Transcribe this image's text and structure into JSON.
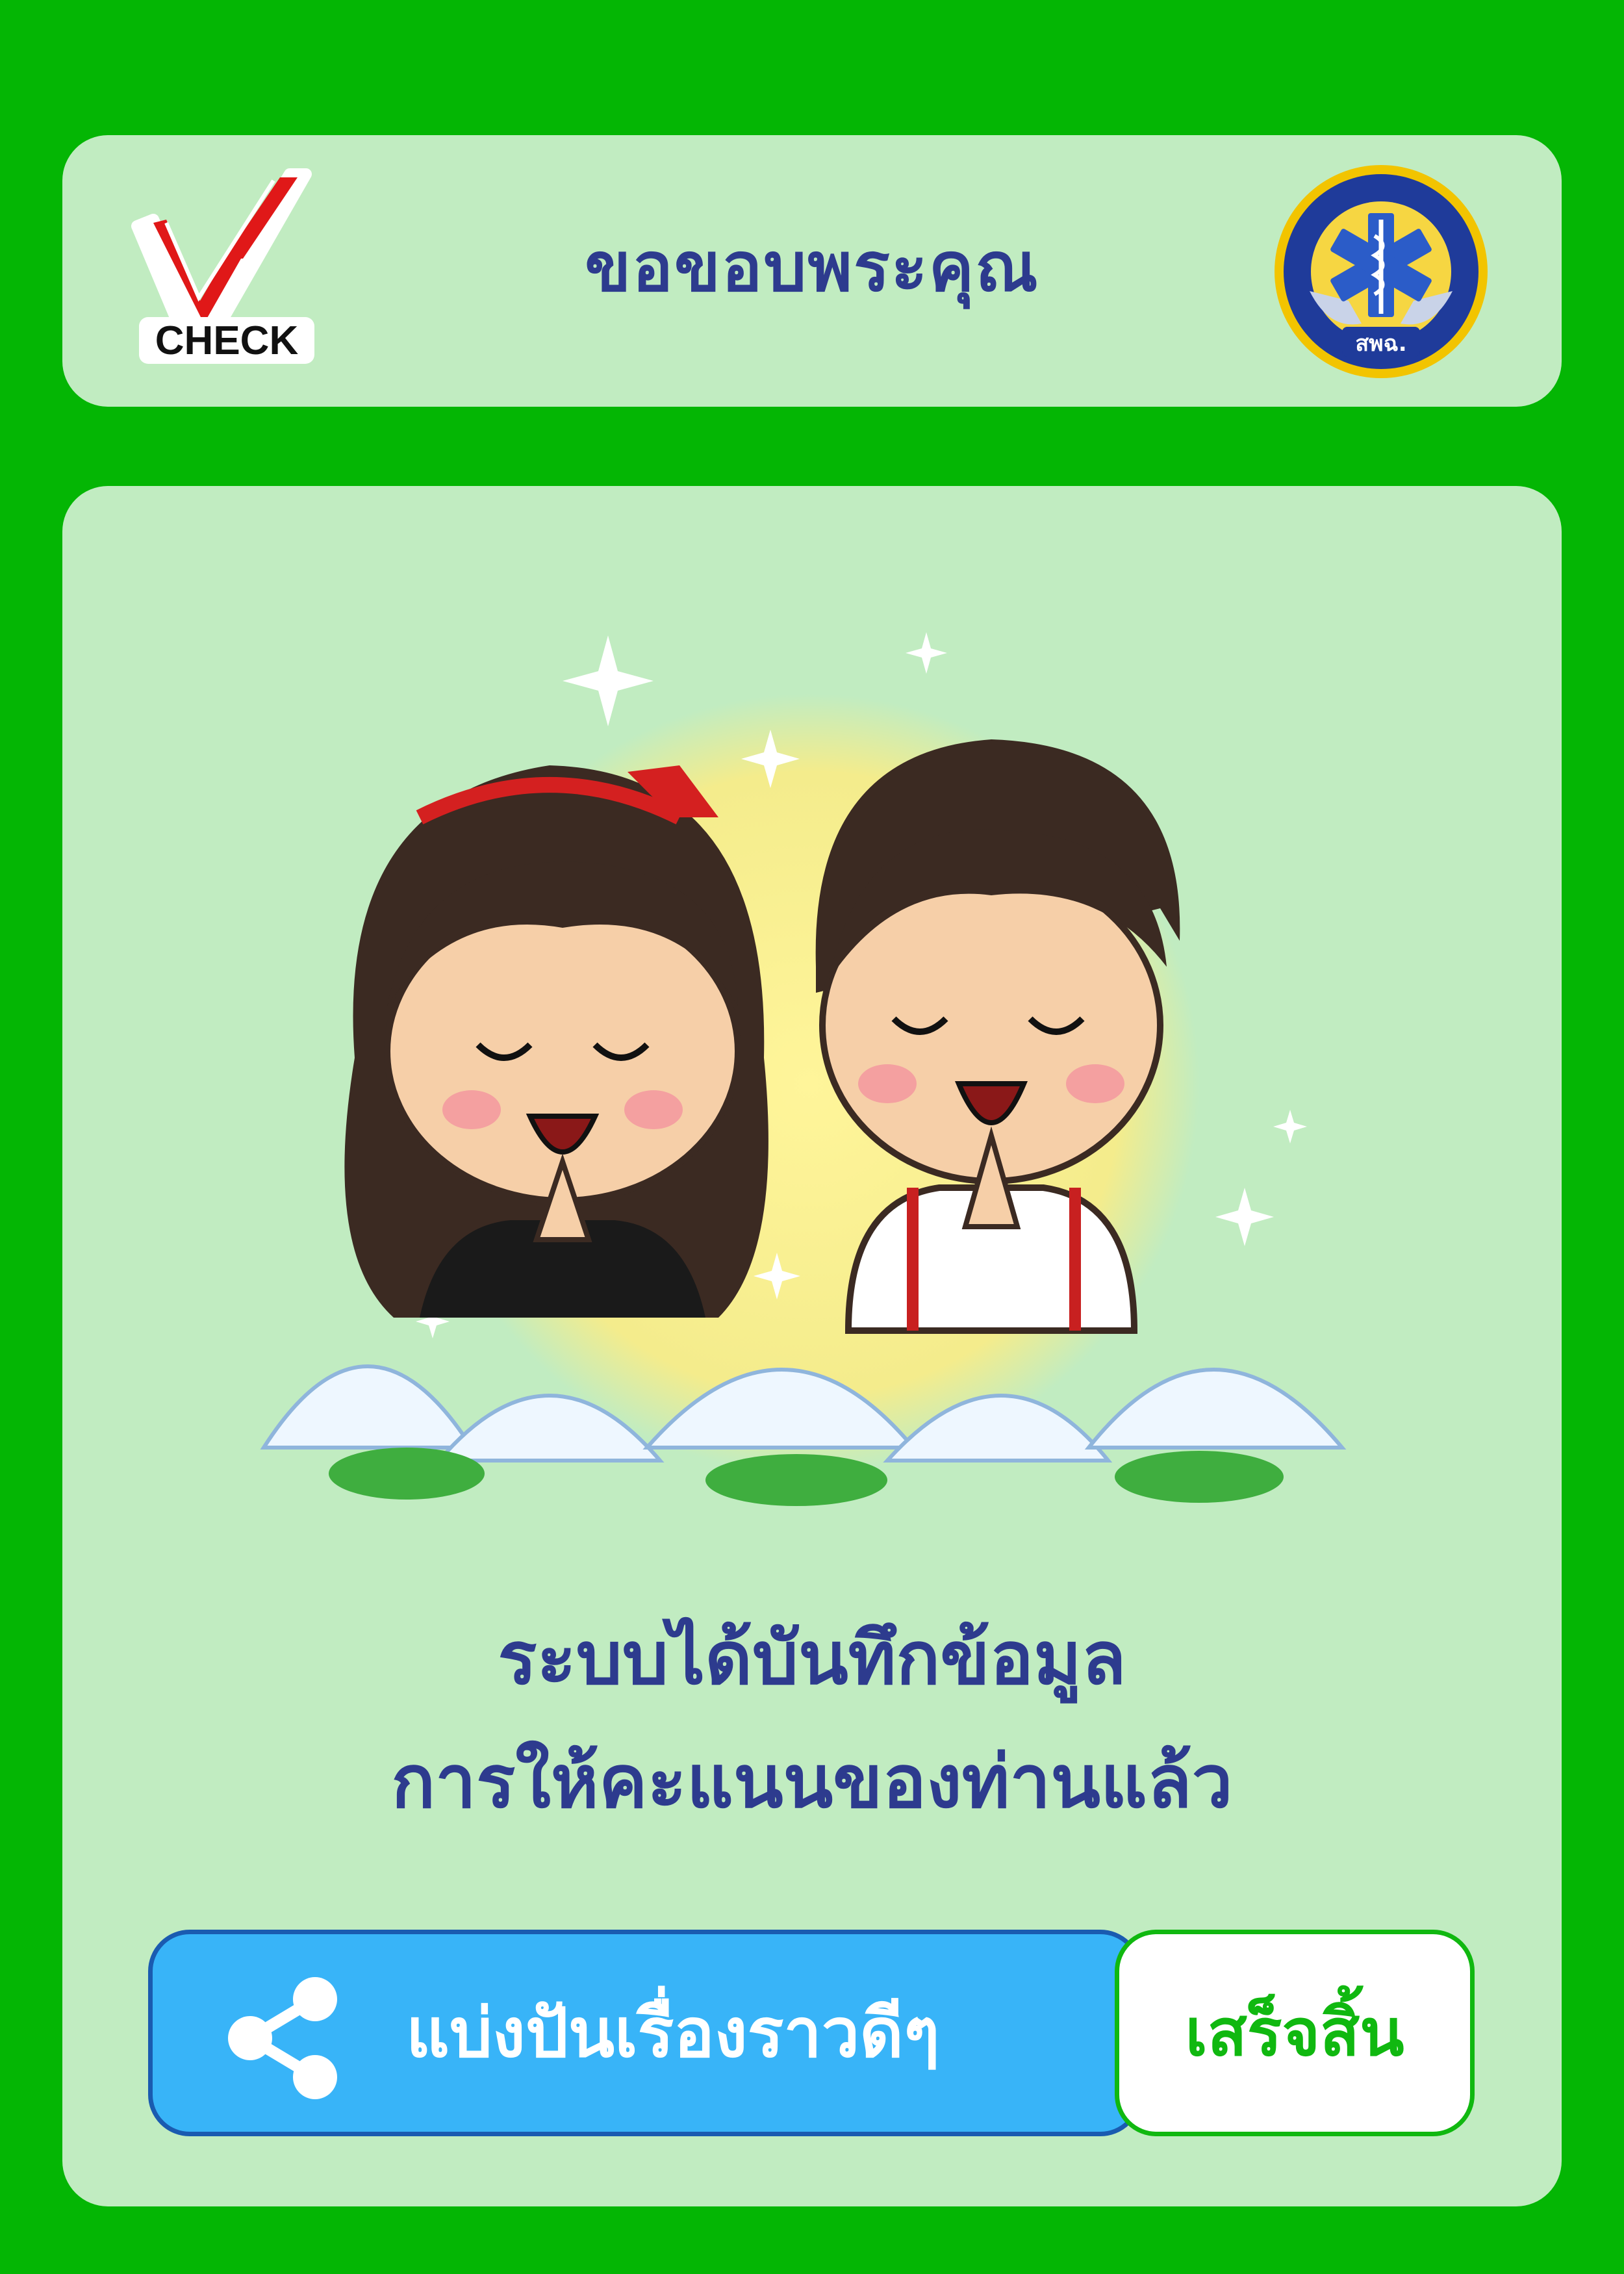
{
  "colors": {
    "background": "#04b604",
    "card": "#c1ecc1",
    "title_text": "#2d3b8e",
    "share_button": "#38b4f8",
    "share_border": "#1a5bb0",
    "done_text": "#10b810"
  },
  "header": {
    "logo_text": "CHECK",
    "title": "ขอขอบพระคุณ",
    "seal_text": "สพฉ."
  },
  "main": {
    "illustration": "thank-you-couple-wai-illustration",
    "message_line1": "ระบบได้บันทึกข้อมูล",
    "message_line2": "การให้คะแนนของท่านแล้ว"
  },
  "actions": {
    "share_icon": "share-icon",
    "share_label": "แบ่งปันเรื่องราวดีๆ",
    "done_label": "เสร็จสิ้น"
  }
}
